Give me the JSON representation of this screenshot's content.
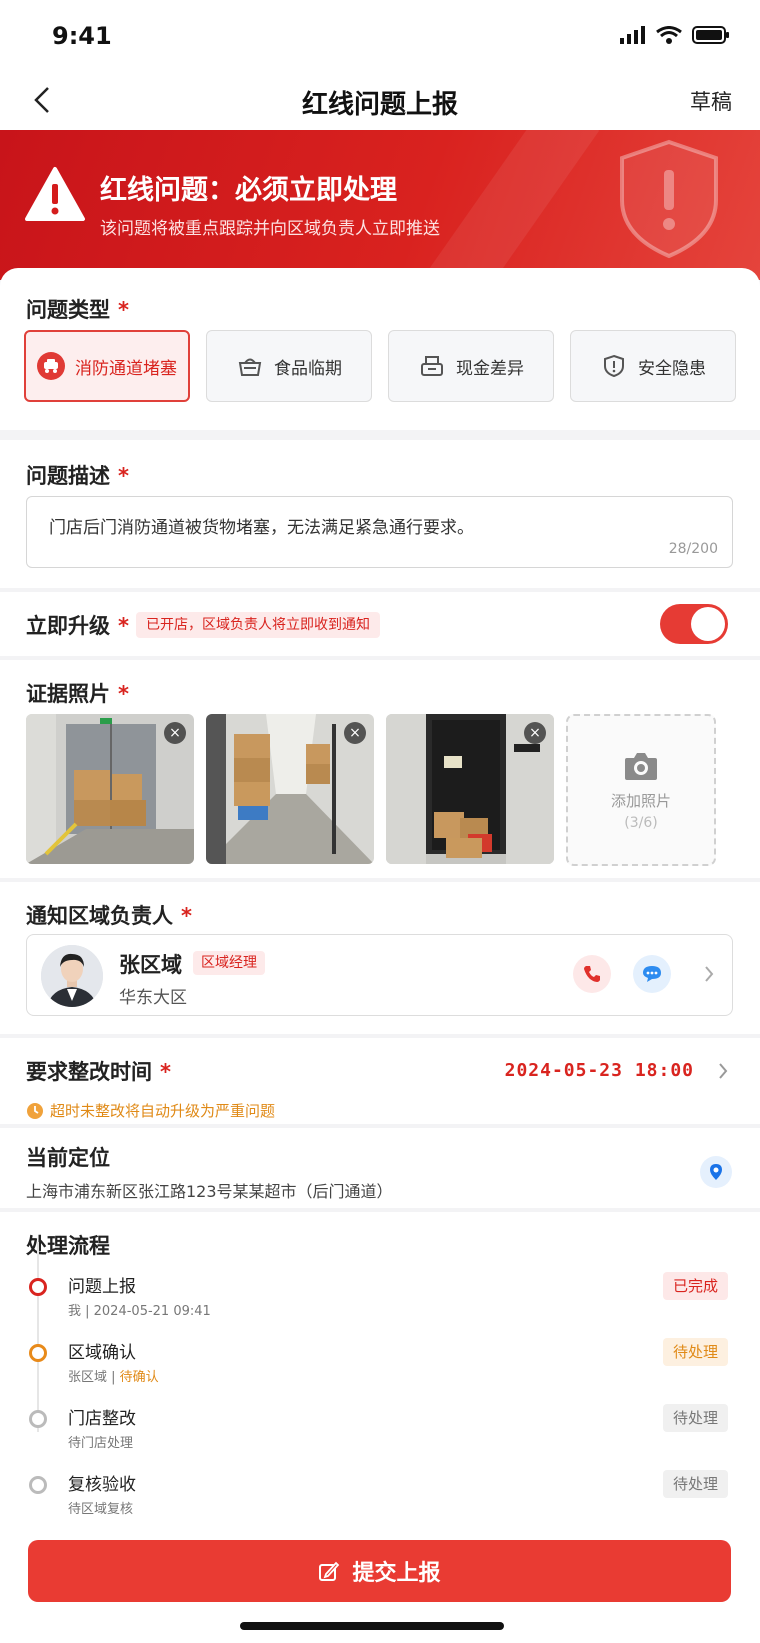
{
  "status_bar": {
    "time": "9:41"
  },
  "nav": {
    "title": "红线问题上报",
    "draft": "草稿"
  },
  "banner": {
    "title": "红线问题：必须立即处理",
    "subtitle": "该问题将被重点跟踪并向区域负责人立即推送"
  },
  "colors": {
    "accent": "#e93b33",
    "warning": "#e08a17",
    "info": "#1a73e8"
  },
  "issue_type": {
    "label": "问题类型",
    "required_mark": "*",
    "options": [
      {
        "label": "消防通道堵塞",
        "icon": "fire-truck-icon",
        "selected": true
      },
      {
        "label": "食品临期",
        "icon": "basket-icon",
        "selected": false
      },
      {
        "label": "现金差异",
        "icon": "cash-register-icon",
        "selected": false
      },
      {
        "label": "安全隐患",
        "icon": "shield-alert-icon",
        "selected": false
      }
    ]
  },
  "description": {
    "label": "问题描述",
    "required_mark": "*",
    "value": "门店后门消防通道被货物堵塞，无法满足紧急通行要求。",
    "count": "28/200"
  },
  "upgrade": {
    "label": "立即升级",
    "required_mark": "*",
    "note": "已开店，区域负责人将立即收到通知",
    "enabled": true
  },
  "photos": {
    "label": "证据照片",
    "required_mark": "*",
    "add_label": "添加照片",
    "add_count": "(3/6)",
    "close_glyph": "×"
  },
  "notify": {
    "label": "通知区域负责人",
    "required_mark": "*",
    "name": "张区域",
    "role": "区域经理",
    "area": "华东大区"
  },
  "deadline": {
    "label": "要求整改时间",
    "required_mark": "*",
    "value": "2024-05-23  18:00",
    "note": "超时未整改将自动升级为严重问题"
  },
  "location": {
    "label": "当前定位",
    "address": "上海市浦东新区张江路123号某某超市（后门通道）"
  },
  "process": {
    "label": "处理流程",
    "steps": [
      {
        "title": "问题上报",
        "sub": "我 | 2024-05-21 09:41",
        "status": "已完成"
      },
      {
        "title": "区域确认",
        "sub": "张区域 | ",
        "sub_highlight": "待确认",
        "status": "待处理"
      },
      {
        "title": "门店整改",
        "sub": "待门店处理",
        "status": "待处理"
      },
      {
        "title": "复核验收",
        "sub": "待区域复核",
        "status": "待处理"
      }
    ]
  },
  "submit": {
    "label": "提交上报"
  }
}
